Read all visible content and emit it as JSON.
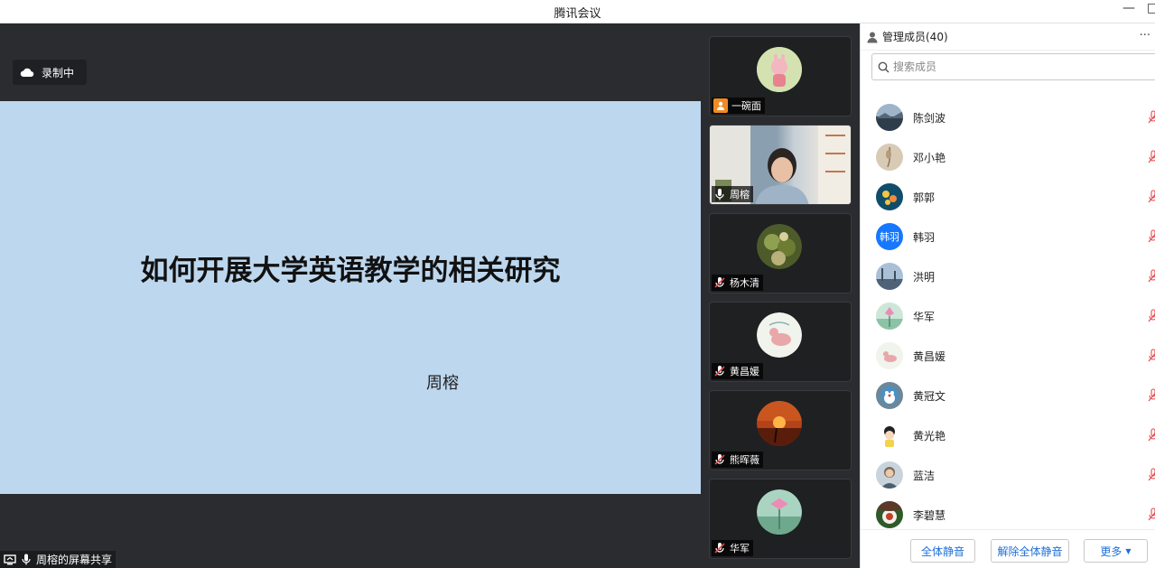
{
  "window": {
    "title": "腾讯会议",
    "minimize": "—",
    "restore": "□"
  },
  "recording": {
    "label": "录制中"
  },
  "slide": {
    "title": "如何开展大学英语教学的相关研究",
    "author": "周榕"
  },
  "share": {
    "label": "周榕的屏幕共享"
  },
  "gallery": [
    {
      "name": "一碗面",
      "kind": "avatar",
      "avatar_color": "#c9d9a6"
    },
    {
      "name": "周榕",
      "kind": "video"
    },
    {
      "name": "杨木清",
      "kind": "avatar",
      "avatar_color": "#6b7a3c"
    },
    {
      "name": "黄昌媛",
      "kind": "avatar",
      "avatar_color": "#eef1ea"
    },
    {
      "name": "熊晖薇",
      "kind": "avatar",
      "avatar_color": "#d2561e"
    },
    {
      "name": "华军",
      "kind": "avatar",
      "avatar_color": "#8bbfa9"
    }
  ],
  "panel": {
    "header": "管理成员(40)",
    "search_placeholder": "搜索成员",
    "members": [
      {
        "name": "陈剑波",
        "avatar_color": "#3b4a5a",
        "avatar_text": ""
      },
      {
        "name": "邓小艳",
        "avatar_color": "#c9b79c",
        "avatar_text": ""
      },
      {
        "name": "郭郭",
        "avatar_color": "#1e5b7a",
        "avatar_text": ""
      },
      {
        "name": "韩羽",
        "avatar_color": "#1677ff",
        "avatar_text": "韩羽"
      },
      {
        "name": "洪明",
        "avatar_color": "#6f8aa8",
        "avatar_text": ""
      },
      {
        "name": "华军",
        "avatar_color": "#b7d9c4",
        "avatar_text": ""
      },
      {
        "name": "黄昌媛",
        "avatar_color": "#eef1ea",
        "avatar_text": ""
      },
      {
        "name": "黄冠文",
        "avatar_color": "#5a7a8f",
        "avatar_text": ""
      },
      {
        "name": "黄光艳",
        "avatar_color": "#f4d34a",
        "avatar_text": ""
      },
      {
        "name": "蓝洁",
        "avatar_color": "#7b8ea0",
        "avatar_text": ""
      },
      {
        "name": "李碧慧",
        "avatar_color": "#5b3a2a",
        "avatar_text": ""
      }
    ],
    "buttons": {
      "mute_all": "全体静音",
      "unmute_all": "解除全体静音",
      "more": "更多"
    }
  },
  "colors": {
    "stage_bg": "#2b2c2f",
    "slide_bg": "#bdd7ee",
    "accent": "#1e6fd9",
    "muted_red": "#e5484d"
  }
}
